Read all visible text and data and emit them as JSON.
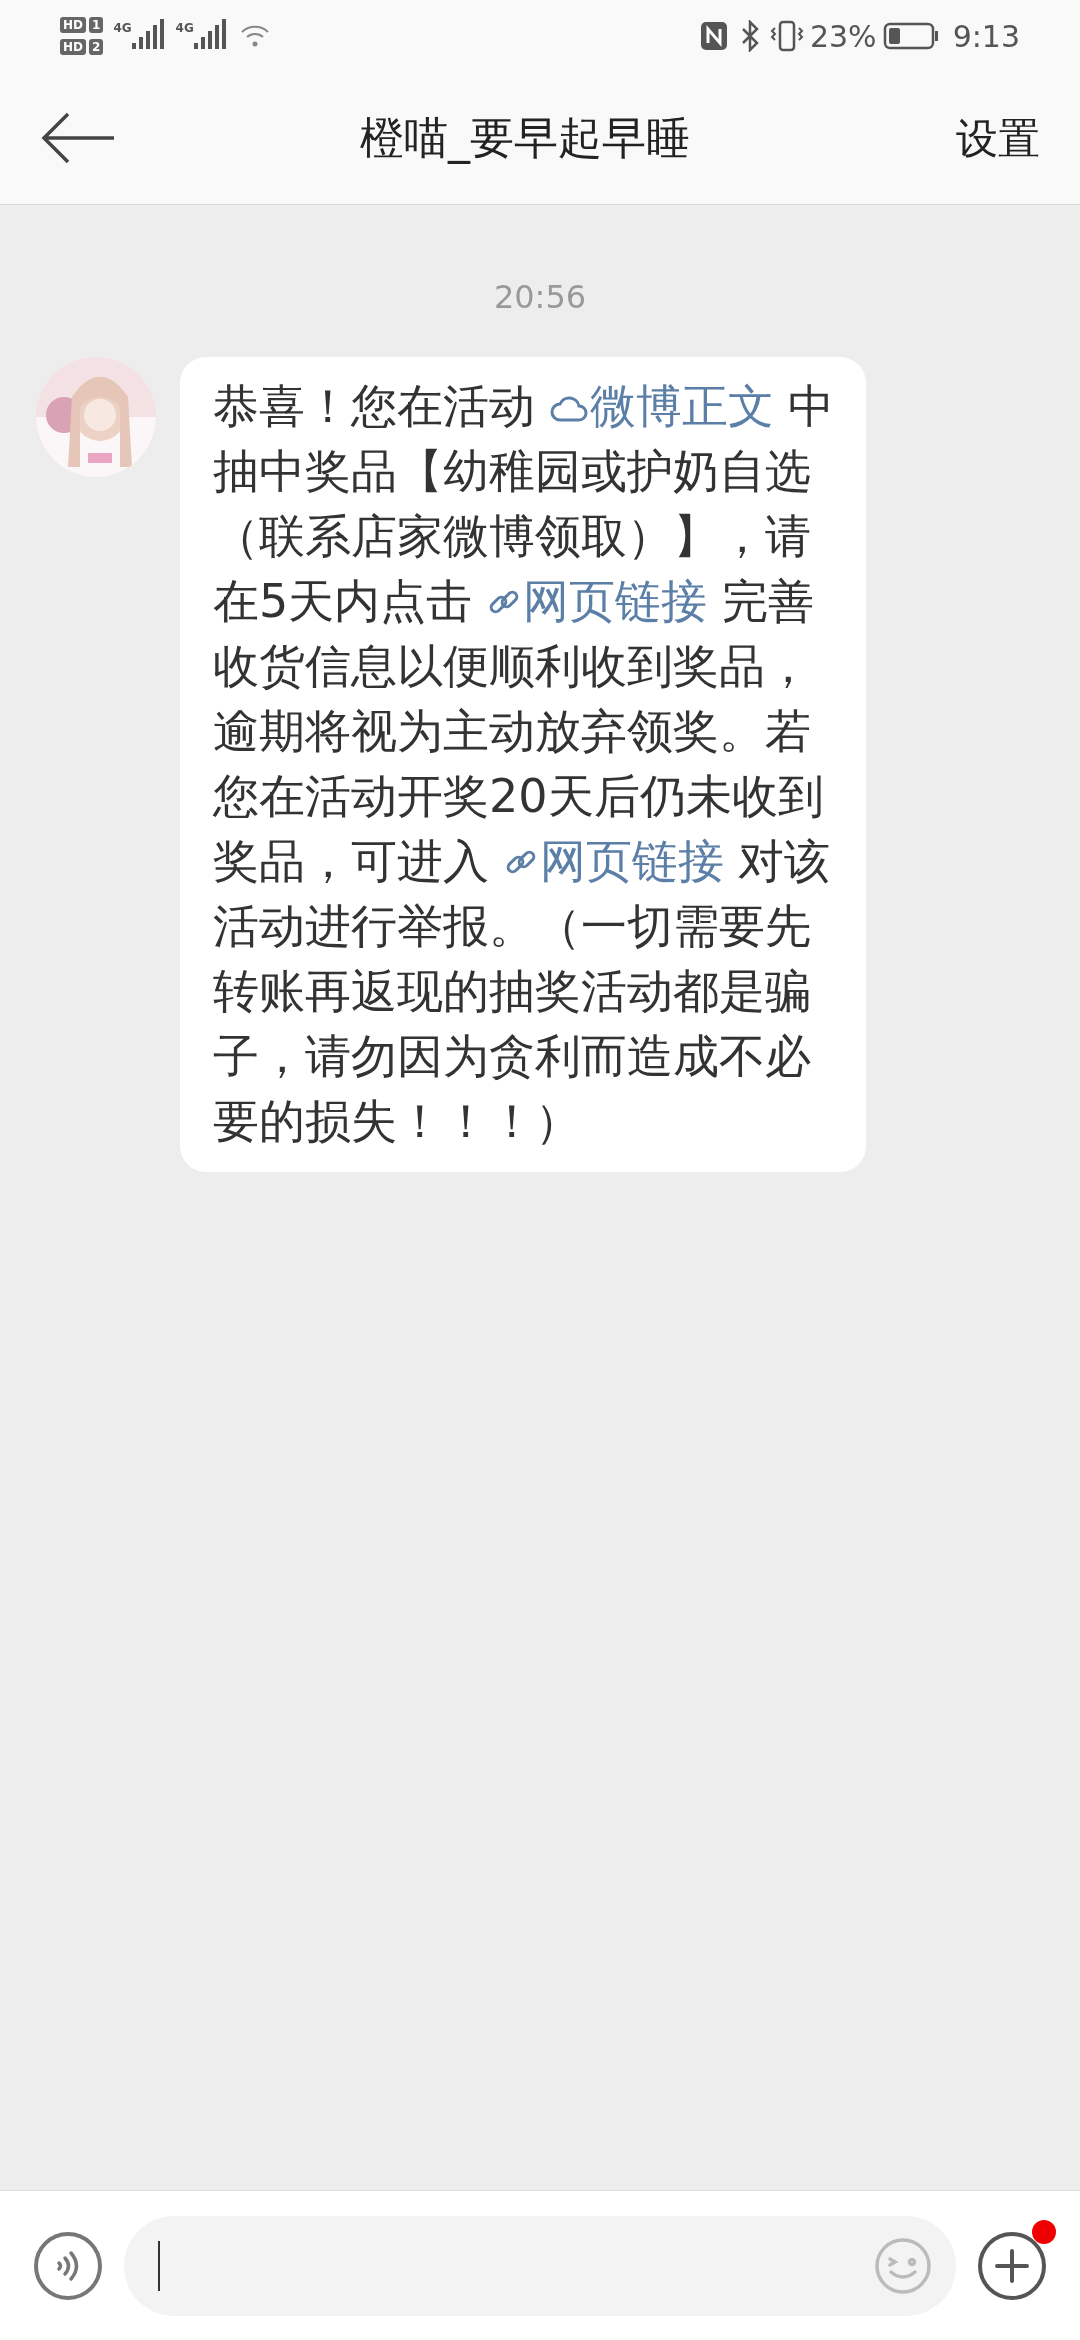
{
  "status_bar": {
    "sims": [
      {
        "badge": "HD",
        "slot": "1"
      },
      {
        "badge": "HD",
        "slot": "2"
      }
    ],
    "networks": [
      "4G",
      "4G"
    ],
    "battery_percent": "23%",
    "time": "9:13"
  },
  "header": {
    "title": "橙喵_要早起早睡",
    "action": "设置"
  },
  "messages": [
    {
      "kind": "time",
      "text": "20:56"
    },
    {
      "kind": "received",
      "segments": [
        {
          "kind": "text",
          "text": "恭喜！您在活动 "
        },
        {
          "kind": "weibo_link",
          "text": "微博正文"
        },
        {
          "kind": "text",
          "text": " 中抽中奖品【幼稚园或护奶自选（联系店家微博领取）】，请在5天内点击 "
        },
        {
          "kind": "web_link",
          "text": "网页链接"
        },
        {
          "kind": "text",
          "text": " 完善收货信息以便顺利收到奖品，逾期将视为主动放弃领奖。若您在活动开奖20天后仍未收到奖品，可进入 "
        },
        {
          "kind": "web_link",
          "text": "网页链接"
        },
        {
          "kind": "text",
          "text": " 对该活动进行举报。（一切需要先转账再返现的抽奖活动都是骗子，请勿因为贪利而造成不必要的损失！！！）"
        }
      ]
    }
  ],
  "composer": {
    "notification_dot": true
  }
}
